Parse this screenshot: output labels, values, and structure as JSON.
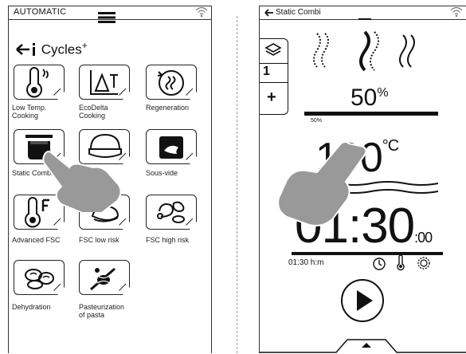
{
  "left": {
    "mode": "AUTOMATIC",
    "back_arrow": "back-arrow-icon",
    "cycles_title": "Cycles",
    "cycles_plus": "+",
    "tiles": [
      {
        "label": "Low Temp.\nCooking",
        "icon": "thermometer-icon"
      },
      {
        "label": "EcoDelta\nCooking",
        "icon": "delta-t-icon"
      },
      {
        "label": "Regeneration",
        "icon": "regeneration-icon"
      },
      {
        "label": "Static Combi",
        "icon": "static-combi-icon"
      },
      {
        "label": "",
        "icon": "bread-icon"
      },
      {
        "label": "Sous-vide",
        "icon": "sous-vide-icon"
      },
      {
        "label": "Advanced FSC",
        "icon": "fsc-thermometer-icon"
      },
      {
        "label": "FSC low risk",
        "icon": "low-risk-food-icon"
      },
      {
        "label": "FSC high risk",
        "icon": "high-risk-food-icon"
      },
      {
        "label": "Dehydration",
        "icon": "dehydration-icon"
      },
      {
        "label": "Pasteurization\nof pasta",
        "icon": "pasta-icon"
      }
    ]
  },
  "right": {
    "title": "Static Combi",
    "humidity_value": "50",
    "humidity_unit": "%",
    "humidity_small": "50%",
    "temp_value": "100",
    "temp_unit": "°C",
    "time_value": "01:30",
    "time_sub": ":00",
    "time_label": "01:30 h:m",
    "side_value": "1",
    "side_plus": "+"
  }
}
